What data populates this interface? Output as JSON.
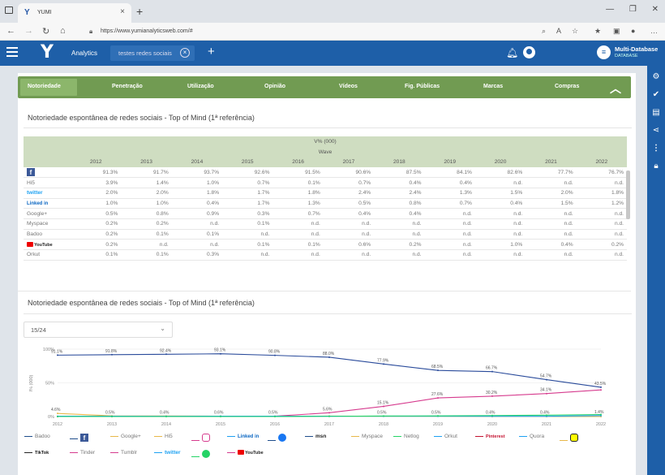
{
  "browser": {
    "tab_title": "YUMI",
    "url": "https://www.yumianalyticsweb.com/#",
    "icons": [
      "tab-actions-icon",
      "back-icon",
      "forward-icon",
      "reload-icon",
      "home-icon",
      "lock-icon",
      "read-aloud-icon",
      "favorites-icon",
      "collections-icon",
      "profile-icon",
      "more-icon"
    ]
  },
  "app": {
    "logo": "Y",
    "nav_analytics": "Analytics",
    "open_tab": "testes redes sociais",
    "db_title": "Multi-Database",
    "db_sub": "DATABASE",
    "colors": {
      "header": "#1e5fa8",
      "catnav": "#719b52",
      "table_header": "#cfddc1"
    }
  },
  "categories": [
    "Notoriedade",
    "Penetração",
    "Utilização",
    "Opinião",
    "Vídeos",
    "Fig. Públicas",
    "Marcas",
    "Compras"
  ],
  "table_section": {
    "title": "Notoriedade espontânea de redes sociais - Top of Mind (1ª referência)",
    "header_top": "V% (000)",
    "header_mid": "Wave",
    "years": [
      "2012",
      "2013",
      "2014",
      "2015",
      "2016",
      "2017",
      "2018",
      "2019",
      "2020",
      "2021",
      "2022"
    ],
    "rows": [
      {
        "label": "facebook",
        "kind": "fb",
        "values": [
          "91.3%",
          "91.7%",
          "93.7%",
          "92.6%",
          "91.5%",
          "90.6%",
          "87.5%",
          "84.1%",
          "82.6%",
          "77.7%",
          "76.7%"
        ]
      },
      {
        "label": "Hi5",
        "kind": "text",
        "values": [
          "3.9%",
          "1.4%",
          "1.0%",
          "0.7%",
          "0.1%",
          "0.7%",
          "0.4%",
          "0.4%",
          "n.d.",
          "n.d.",
          "n.d."
        ]
      },
      {
        "label": "twitter",
        "kind": "twt",
        "values": [
          "2.0%",
          "2.0%",
          "1.8%",
          "1.7%",
          "1.8%",
          "2.4%",
          "2.4%",
          "1.3%",
          "1.5%",
          "2.0%",
          "1.8%"
        ]
      },
      {
        "label": "Linked in",
        "kind": "lnk",
        "values": [
          "1.0%",
          "1.0%",
          "0.4%",
          "1.7%",
          "1.3%",
          "0.5%",
          "0.8%",
          "0.7%",
          "0.4%",
          "1.5%",
          "1.2%"
        ]
      },
      {
        "label": "Google+",
        "kind": "text",
        "values": [
          "0.5%",
          "0.8%",
          "0.9%",
          "0.3%",
          "0.7%",
          "0.4%",
          "0.4%",
          "n.d.",
          "n.d.",
          "n.d.",
          "n.d."
        ]
      },
      {
        "label": "Myspace",
        "kind": "text",
        "values": [
          "0.2%",
          "0.2%",
          "n.d.",
          "0.1%",
          "n.d.",
          "n.d.",
          "n.d.",
          "n.d.",
          "n.d.",
          "n.d.",
          "n.d."
        ]
      },
      {
        "label": "Badoo",
        "kind": "text",
        "values": [
          "0.2%",
          "0.1%",
          "0.1%",
          "n.d.",
          "n.d.",
          "n.d.",
          "n.d.",
          "n.d.",
          "n.d.",
          "n.d.",
          "n.d."
        ]
      },
      {
        "label": "YouTube",
        "kind": "yt",
        "values": [
          "0.2%",
          "n.d.",
          "n.d.",
          "0.1%",
          "0.1%",
          "0.6%",
          "0.2%",
          "n.d.",
          "1.0%",
          "0.4%",
          "0.2%"
        ]
      },
      {
        "label": "Orkut",
        "kind": "text",
        "values": [
          "0.1%",
          "0.1%",
          "0.3%",
          "n.d.",
          "n.d.",
          "n.d.",
          "n.d.",
          "n.d.",
          "n.d.",
          "n.d.",
          "n.d."
        ]
      }
    ]
  },
  "chart_section": {
    "title": "Notoriedade espontânea de redes sociais - Top of Mind (1ª referência)",
    "select_value": "15/24"
  },
  "chart_data": {
    "type": "line",
    "ylabel": "I% (000)",
    "y_ticks": [
      "100%",
      "50%",
      "0%"
    ],
    "ylim": [
      0,
      100
    ],
    "x": [
      "2012",
      "2013",
      "2014",
      "2015",
      "2016",
      "2017",
      "2018",
      "2019",
      "2020",
      "2021",
      "2022"
    ],
    "series": [
      {
        "name": "facebook",
        "color": "#2a4b9b",
        "values": [
          91.1,
          91.8,
          92.4,
          93.1,
          90.8,
          88.0,
          77.9,
          68.5,
          66.7,
          54.7,
          43.5
        ],
        "labels": [
          "91.1%",
          "91.8%",
          "92.4%",
          "93.1%",
          "90.8%",
          "88.0%",
          "77.9%",
          "68.5%",
          "66.7%",
          "54.7%",
          "43.5%"
        ]
      },
      {
        "name": "Instagram",
        "color": "#d63b8e",
        "values": [
          0,
          0.2,
          0.4,
          0.6,
          0.5,
          5.6,
          15.1,
          27.6,
          30.2,
          34.1,
          39.5
        ],
        "labels": [
          "",
          "",
          "",
          "",
          "",
          "5.6%",
          "15.1%",
          "27.6%",
          "30.2%",
          "34.1%",
          ""
        ]
      },
      {
        "name": "Hi5",
        "color": "#e8b84a",
        "values": [
          4.6,
          1.0,
          0.8,
          0.6,
          0.2,
          0.7,
          0.4,
          0.4,
          0,
          0,
          0
        ],
        "labels": [
          "4.6%",
          "",
          "",
          "",
          "",
          "",
          "",
          "",
          "",
          "",
          ""
        ]
      },
      {
        "name": "twitter",
        "color": "#1da1f2",
        "values": [
          0.5,
          0.5,
          0.4,
          0.6,
          0.5,
          0.5,
          0.5,
          0.5,
          0.4,
          0.4,
          1.4
        ],
        "labels": [
          "",
          "0.5%",
          "0.4%",
          "0.6%",
          "0.5%",
          "",
          "0.5%",
          "0.5%",
          "0.4%",
          "0.4%",
          "1.4%"
        ]
      },
      {
        "name": "WhatsApp",
        "color": "#25d366",
        "values": [
          0,
          0,
          0,
          0,
          0,
          0.3,
          0.8,
          1.0,
          1.5,
          2.0,
          3.0
        ],
        "labels": [
          "",
          "",
          "",
          "",
          "",
          "",
          "",
          "",
          "",
          "",
          ""
        ]
      }
    ]
  },
  "legend": [
    {
      "label": "Badoo",
      "color": "#1f4e8c",
      "kind": "text"
    },
    {
      "label": "facebook",
      "color": "#1f4e8c",
      "kind": "fb"
    },
    {
      "label": "Google+",
      "color": "#e8b84a",
      "kind": "text"
    },
    {
      "label": "Hi5",
      "color": "#e8b84a",
      "kind": "text"
    },
    {
      "label": "Instagram",
      "color": "#d63b8e",
      "kind": "ig"
    },
    {
      "label": "Linked in",
      "color": "#1da1f2",
      "kind": "lnk"
    },
    {
      "label": "Messenger",
      "color": "#1f4e8c",
      "kind": "msg"
    },
    {
      "label": "msn",
      "color": "#1f4e8c",
      "kind": "msn"
    },
    {
      "label": "Myspace",
      "color": "#e8b84a",
      "kind": "text"
    },
    {
      "label": "Netlog",
      "color": "#25d366",
      "kind": "text"
    },
    {
      "label": "Orkut",
      "color": "#1da1f2",
      "kind": "text"
    },
    {
      "label": "Pinterest",
      "color": "#c41230",
      "kind": "pin"
    },
    {
      "label": "Quora",
      "color": "#1da1f2",
      "kind": "text"
    },
    {
      "label": "Snapchat",
      "color": "#e8b84a",
      "kind": "snap"
    },
    {
      "label": "TikTok",
      "color": "#222222",
      "kind": "tiktok"
    },
    {
      "label": "Tinder",
      "color": "#d63b8e",
      "kind": "text"
    },
    {
      "label": "Tumblr",
      "color": "#d63b8e",
      "kind": "text"
    },
    {
      "label": "twitter",
      "color": "#1da1f2",
      "kind": "twt"
    },
    {
      "label": "WhatsApp",
      "color": "#25d366",
      "kind": "wa"
    },
    {
      "label": "YouTube",
      "color": "#d63b8e",
      "kind": "yt"
    }
  ]
}
